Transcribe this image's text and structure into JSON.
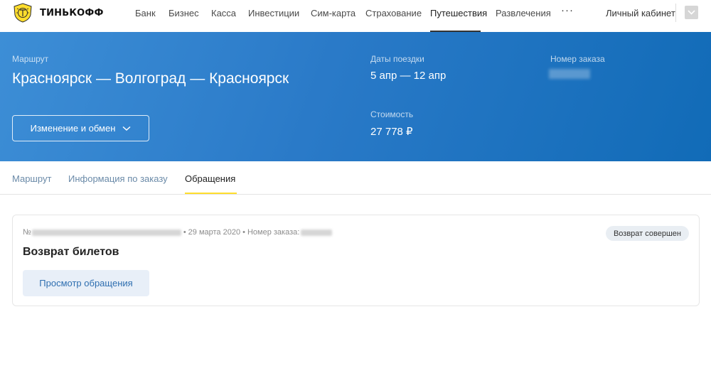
{
  "brand": {
    "name": "ТИНЬКОФФ"
  },
  "nav": {
    "items": [
      {
        "label": "Банк"
      },
      {
        "label": "Бизнес"
      },
      {
        "label": "Касса"
      },
      {
        "label": "Инвестиции"
      },
      {
        "label": "Сим-карта"
      },
      {
        "label": "Страхование"
      },
      {
        "label": "Путешествия",
        "active": true
      },
      {
        "label": "Развлечения"
      }
    ],
    "more_label": "···",
    "cabinet_label": "Личный кабинет"
  },
  "order": {
    "route_label": "Маршрут",
    "route": "Красноярск — Волгоград — Красноярск",
    "dates_label": "Даты поездки",
    "dates": "5 апр — 12 апр",
    "order_number_label": "Номер заказа",
    "cost_label": "Стоимость",
    "cost": "27 778 ₽",
    "change_button": "Изменение и обмен"
  },
  "tabs": [
    {
      "label": "Маршрут"
    },
    {
      "label": "Информация по заказу"
    },
    {
      "label": "Обращения",
      "active": true
    }
  ],
  "request": {
    "number_prefix": "№",
    "date": "29 марта 2020",
    "order_number_prefix": "Номер заказа:",
    "separator": "•",
    "status": "Возврат совершен",
    "title": "Возврат билетов",
    "view_button": "Просмотр обращения"
  },
  "colors": {
    "hero_start": "#3d8ed6",
    "hero_end": "#116bb7",
    "tab_accent": "#ffdd2d",
    "link": "#2f6fb0"
  }
}
